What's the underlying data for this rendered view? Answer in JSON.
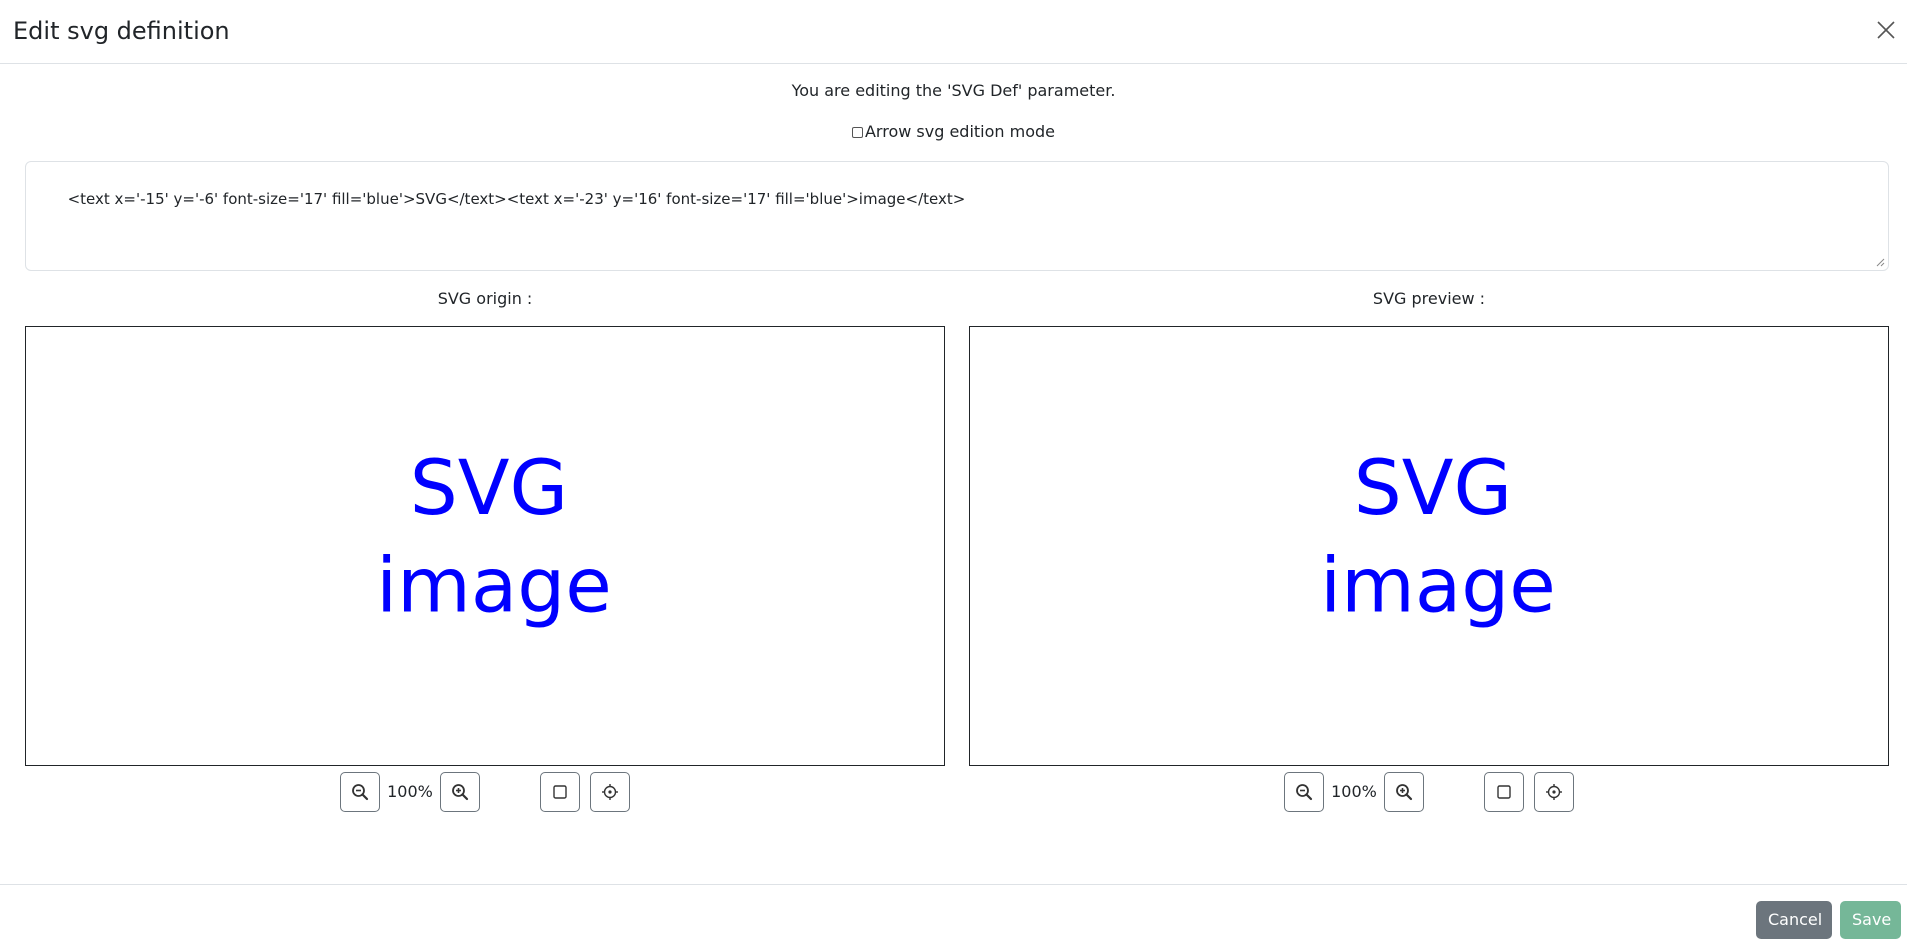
{
  "colors": {
    "svg_text": "#0000ff",
    "cancel_button": "#6c757d",
    "save_button": "#75b798",
    "border": "#dee2e6"
  },
  "header": {
    "title": "Edit svg definition",
    "close_icon": "close-icon"
  },
  "body": {
    "info": "You are editing the 'SVG Def' parameter.",
    "arrow_mode_label": "Arrow svg edition mode",
    "arrow_mode_checked": false,
    "svg_definition": "<text x='-15' y='-6' font-size='17' fill='blue'>SVG</text><text x='-23' y='16' font-size='17' fill='blue'>image</text>",
    "origin": {
      "label": "SVG origin :",
      "line1": "SVG",
      "line2": "image",
      "zoom": "100%"
    },
    "preview": {
      "label": "SVG preview :",
      "line1": "SVG",
      "line2": "image",
      "zoom": "100%"
    },
    "icons": {
      "zoom_out": "zoom-out-icon",
      "zoom_in": "zoom-in-icon",
      "fit": "square-icon",
      "center": "crosshair-icon"
    }
  },
  "footer": {
    "cancel_label": "Cancel",
    "save_label": "Save"
  }
}
